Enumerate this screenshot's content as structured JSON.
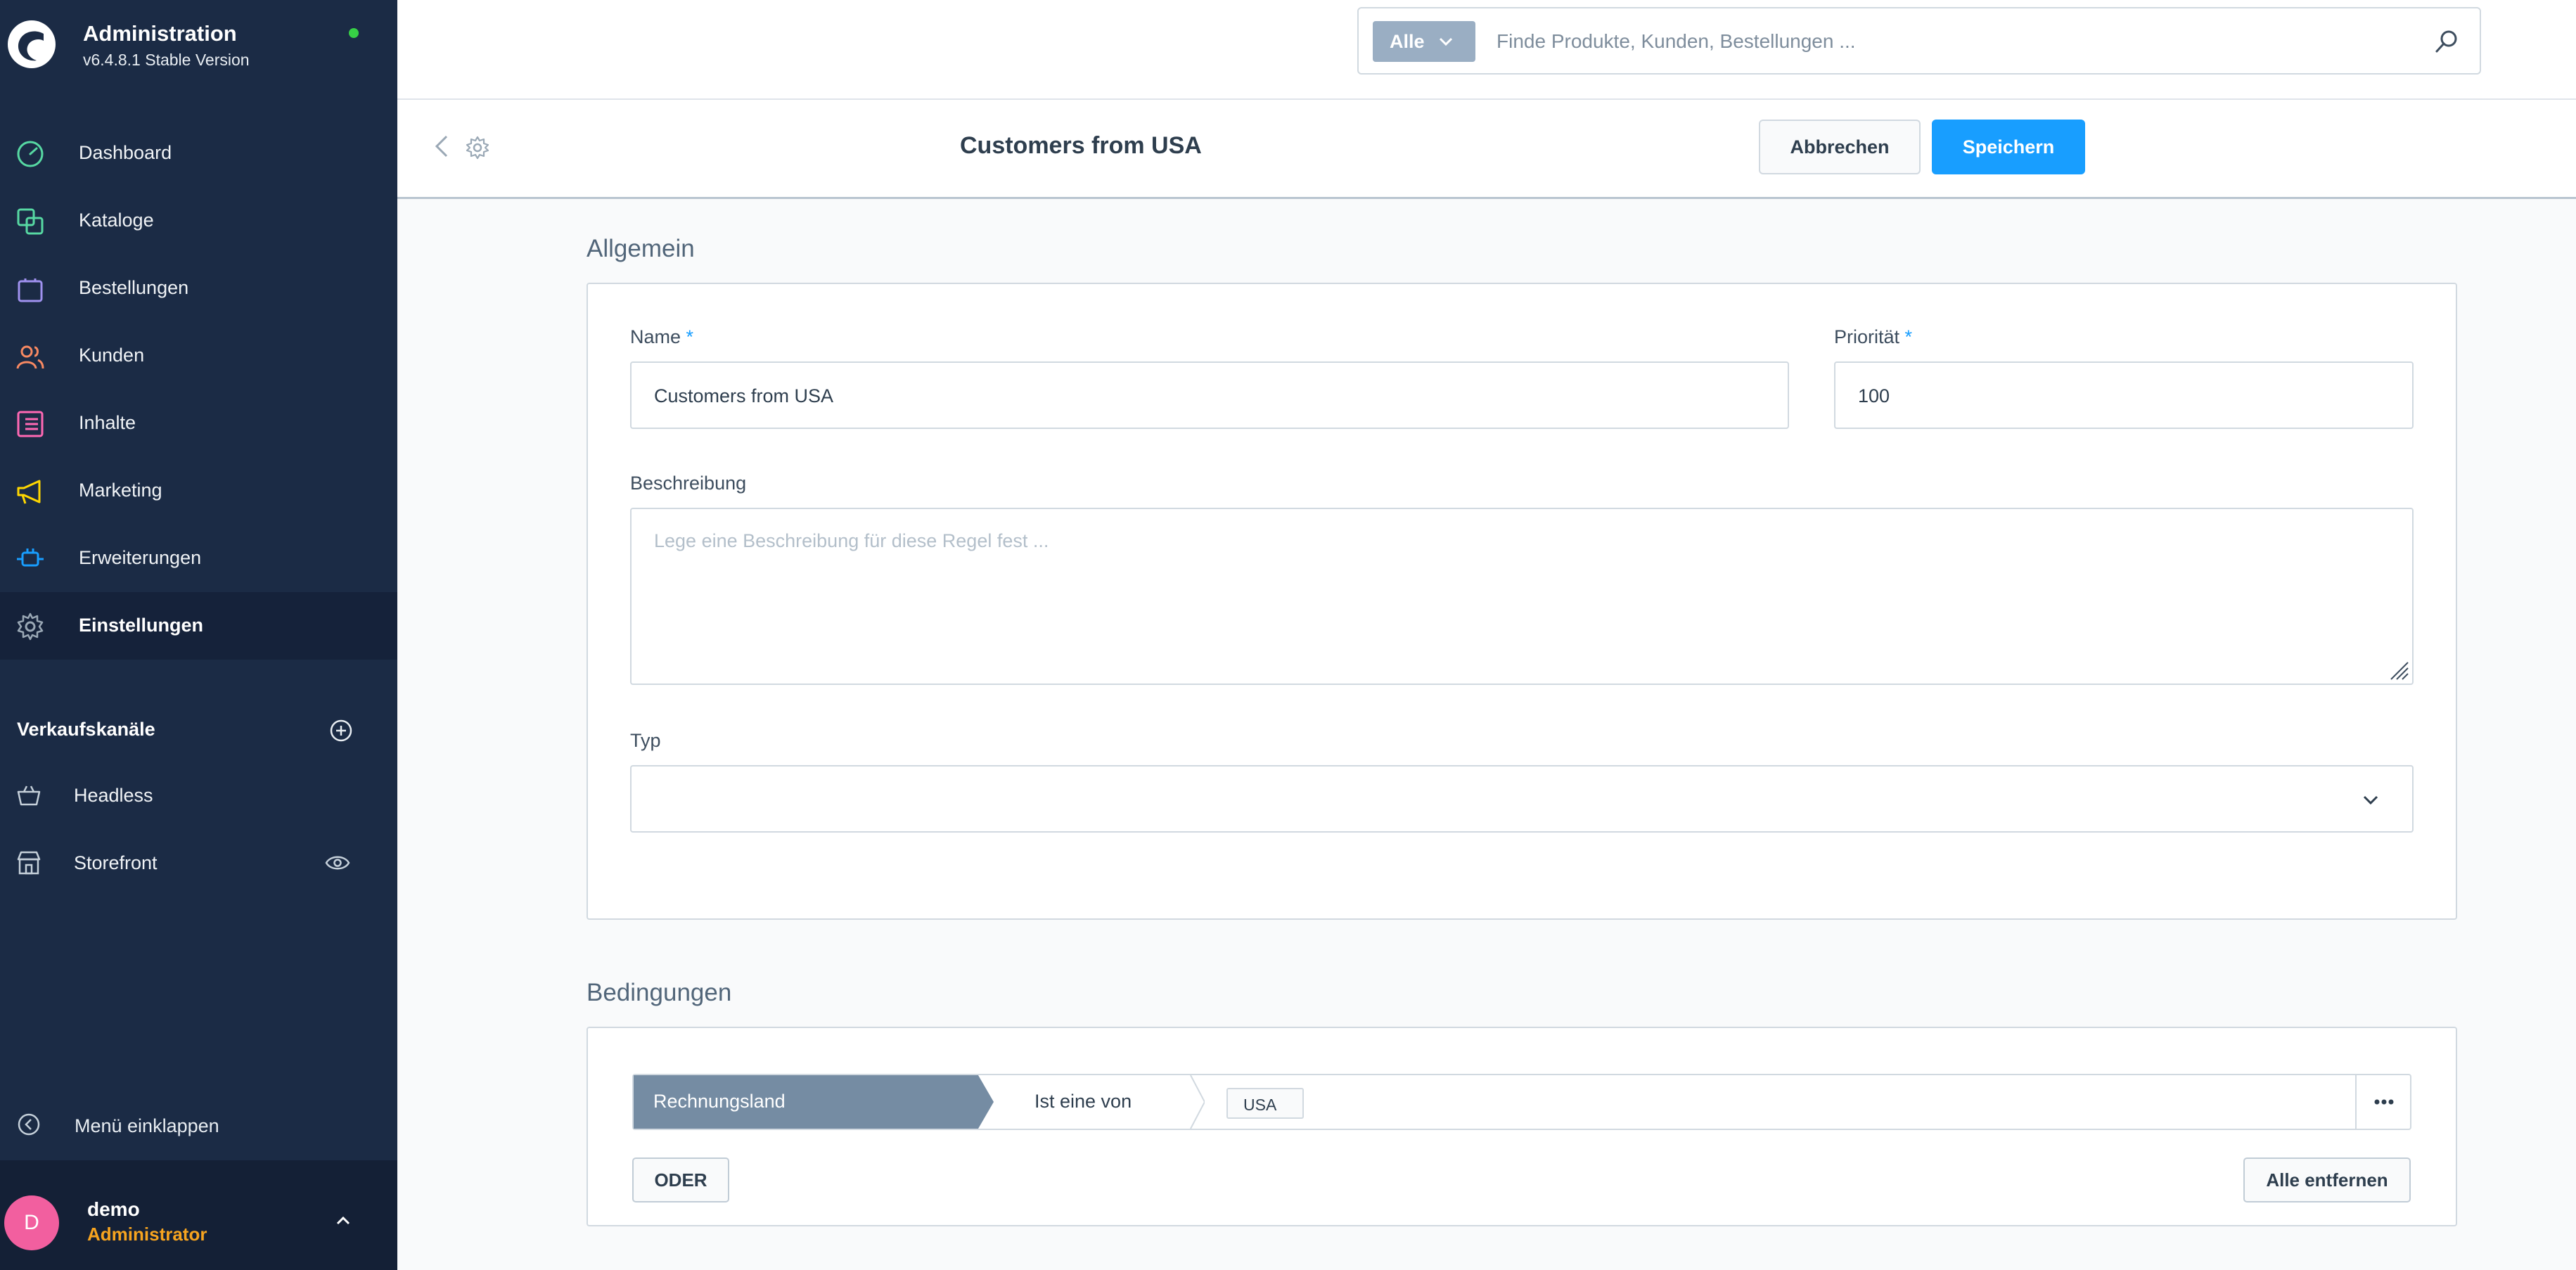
{
  "app": {
    "title": "Administration",
    "version": "v6.4.8.1 Stable Version"
  },
  "sidebar": {
    "items": [
      {
        "label": "Dashboard",
        "icon": "dashboard-icon",
        "color": "#57d9a3"
      },
      {
        "label": "Kataloge",
        "icon": "catalogue-icon",
        "color": "#57d9a3"
      },
      {
        "label": "Bestellungen",
        "icon": "orders-icon",
        "color": "#a092f0"
      },
      {
        "label": "Kunden",
        "icon": "customers-icon",
        "color": "#f88962"
      },
      {
        "label": "Inhalte",
        "icon": "content-icon",
        "color": "#ff68b4"
      },
      {
        "label": "Marketing",
        "icon": "marketing-icon",
        "color": "#ffd700"
      },
      {
        "label": "Erweiterungen",
        "icon": "extensions-icon",
        "color": "#189eff"
      },
      {
        "label": "Einstellungen",
        "icon": "settings-icon",
        "color": "#9aa8b5"
      }
    ],
    "active_index": 7,
    "sales_channels": {
      "heading": "Verkaufskanäle",
      "items": [
        {
          "label": "Headless",
          "icon": "basket-icon"
        },
        {
          "label": "Storefront",
          "icon": "storefront-icon"
        }
      ]
    },
    "collapse_label": "Menü einklappen",
    "user": {
      "initial": "D",
      "name": "demo",
      "role": "Administrator"
    }
  },
  "search": {
    "type_label": "Alle",
    "placeholder": "Finde Produkte, Kunden, Bestellungen ..."
  },
  "smartbar": {
    "title": "Customers from USA",
    "cancel_label": "Abbrechen",
    "save_label": "Speichern"
  },
  "general": {
    "section_title": "Allgemein",
    "name_label": "Name",
    "name_value": "Customers from USA",
    "priority_label": "Priorität",
    "priority_value": "100",
    "required_mark": "*",
    "description_label": "Beschreibung",
    "description_placeholder": "Lege eine Beschreibung für diese Regel fest ...",
    "type_label": "Typ",
    "type_value": ""
  },
  "conditions": {
    "section_title": "Bedingungen",
    "field": "Rechnungsland",
    "operator": "Ist eine von",
    "values": [
      "USA"
    ],
    "or_label": "ODER",
    "remove_all_label": "Alle entfernen"
  },
  "colors": {
    "sidebar_bg": "#1b2b45",
    "accent": "#189eff",
    "condition_field_bg": "#758ca3",
    "status_online": "#37d046",
    "avatar_bg": "#f25f9f",
    "role_text": "#f7a41f"
  }
}
